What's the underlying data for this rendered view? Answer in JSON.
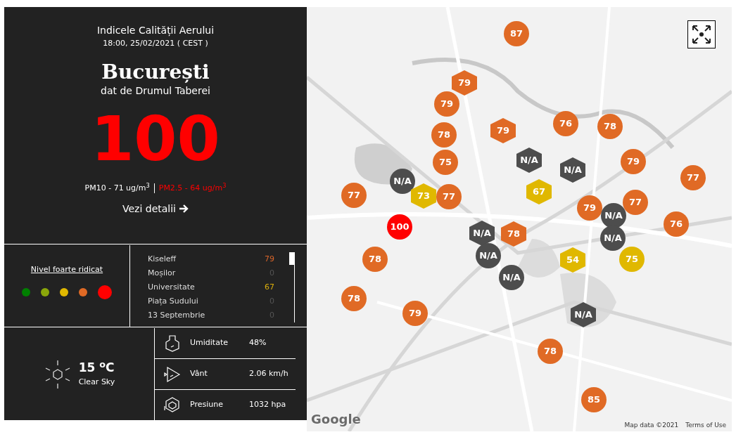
{
  "summary": {
    "title": "Indicele Calității Aerului",
    "timestamp": "18:00, 25/02/2021 ( CEST )",
    "city": "București",
    "source": "dat de Drumul Taberei",
    "aqi": {
      "value": "100",
      "color": "#ff0000"
    },
    "pollutants": [
      {
        "text": "PM10 - 71 ug/m$^{3}$",
        "color": "#ffffff"
      },
      {
        "text": "PM2.5 - 64 ug/m$^{3}$",
        "color": "#ff0000"
      }
    ],
    "details_link": "Vezi detalii"
  },
  "legend": {
    "label": "Nivel foarte ridicat",
    "levels": [
      {
        "color": "#008000",
        "selected": false
      },
      {
        "color": "#8aa60a",
        "selected": false
      },
      {
        "color": "#e0b800",
        "selected": false
      },
      {
        "color": "#e06a25",
        "selected": false
      },
      {
        "color": "#ff0000",
        "selected": true
      }
    ]
  },
  "stations": [
    {
      "name": "Kiseleff",
      "value": "79",
      "color": "#d9652a"
    },
    {
      "name": "Moșilor",
      "value": "0",
      "color": "#555555"
    },
    {
      "name": "Universitate",
      "value": "67",
      "color": "#d9ad0b"
    },
    {
      "name": "Piața Sudului",
      "value": "0",
      "color": "#555555"
    },
    {
      "name": "13 Septembrie",
      "value": "0",
      "color": "#555555"
    }
  ],
  "weather": {
    "temperature": "15 $^{o}$C",
    "condition": "Clear Sky",
    "metrics": [
      {
        "kind": "humidity",
        "label": "Umiditate",
        "value": "48%"
      },
      {
        "kind": "wind",
        "label": "Vânt",
        "value": "2.06 km/h"
      },
      {
        "kind": "pressure",
        "label": "Presiune",
        "value": "1032 hpa"
      }
    ]
  },
  "map": {
    "markers": [
      {
        "value": "87",
        "kind": "circle",
        "color": "#e06a25"
      },
      {
        "value": "79",
        "kind": "hexagon",
        "color": "#e06a25"
      },
      {
        "value": "79",
        "kind": "circle",
        "color": "#e06a25"
      },
      {
        "value": "78",
        "kind": "circle",
        "color": "#e06a25"
      },
      {
        "value": "79",
        "kind": "hexagon",
        "color": "#e06a25"
      },
      {
        "value": "76",
        "kind": "circle",
        "color": "#e06a25"
      },
      {
        "value": "78",
        "kind": "circle",
        "color": "#e06a25"
      },
      {
        "value": "N/A",
        "kind": "circle",
        "color": "#4d4d4d"
      },
      {
        "value": "75",
        "kind": "circle",
        "color": "#e06a25"
      },
      {
        "value": "N/A",
        "kind": "hexagon",
        "color": "#4d4d4d"
      },
      {
        "value": "N/A",
        "kind": "hexagon",
        "color": "#4d4d4d"
      },
      {
        "value": "79",
        "kind": "circle",
        "color": "#e06a25"
      },
      {
        "value": "77",
        "kind": "circle",
        "color": "#e06a25"
      },
      {
        "value": "77",
        "kind": "circle",
        "color": "#e06a25"
      },
      {
        "value": "73",
        "kind": "hexagon",
        "color": "#e0b800"
      },
      {
        "value": "77",
        "kind": "circle",
        "color": "#e06a25"
      },
      {
        "value": "67",
        "kind": "hexagon",
        "color": "#e0b800"
      },
      {
        "value": "79",
        "kind": "circle",
        "color": "#e06a25"
      },
      {
        "value": "N/A",
        "kind": "circle",
        "color": "#4d4d4d"
      },
      {
        "value": "77",
        "kind": "circle",
        "color": "#e06a25"
      },
      {
        "value": "100",
        "kind": "circle",
        "color": "#ff0000"
      },
      {
        "value": "N/A",
        "kind": "hexagon",
        "color": "#4d4d4d"
      },
      {
        "value": "78",
        "kind": "hexagon",
        "color": "#e06a25"
      },
      {
        "value": "N/A",
        "kind": "circle",
        "color": "#4d4d4d"
      },
      {
        "value": "76",
        "kind": "circle",
        "color": "#e06a25"
      },
      {
        "value": "78",
        "kind": "circle",
        "color": "#e06a25"
      },
      {
        "value": "N/A",
        "kind": "circle",
        "color": "#4d4d4d"
      },
      {
        "value": "54",
        "kind": "hexagon",
        "color": "#e0b800"
      },
      {
        "value": "75",
        "kind": "circle",
        "color": "#e0b800"
      },
      {
        "value": "N/A",
        "kind": "circle",
        "color": "#4d4d4d"
      },
      {
        "value": "78",
        "kind": "circle",
        "color": "#e06a25"
      },
      {
        "value": "79",
        "kind": "circle",
        "color": "#e06a25"
      },
      {
        "value": "N/A",
        "kind": "hexagon",
        "color": "#4d4d4d"
      },
      {
        "value": "78",
        "kind": "circle",
        "color": "#e06a25"
      },
      {
        "value": "85",
        "kind": "circle",
        "color": "#e06a25"
      }
    ],
    "logo": "Google",
    "attribution": "Map data ©2021",
    "terms_link": "Terms of Use"
  }
}
